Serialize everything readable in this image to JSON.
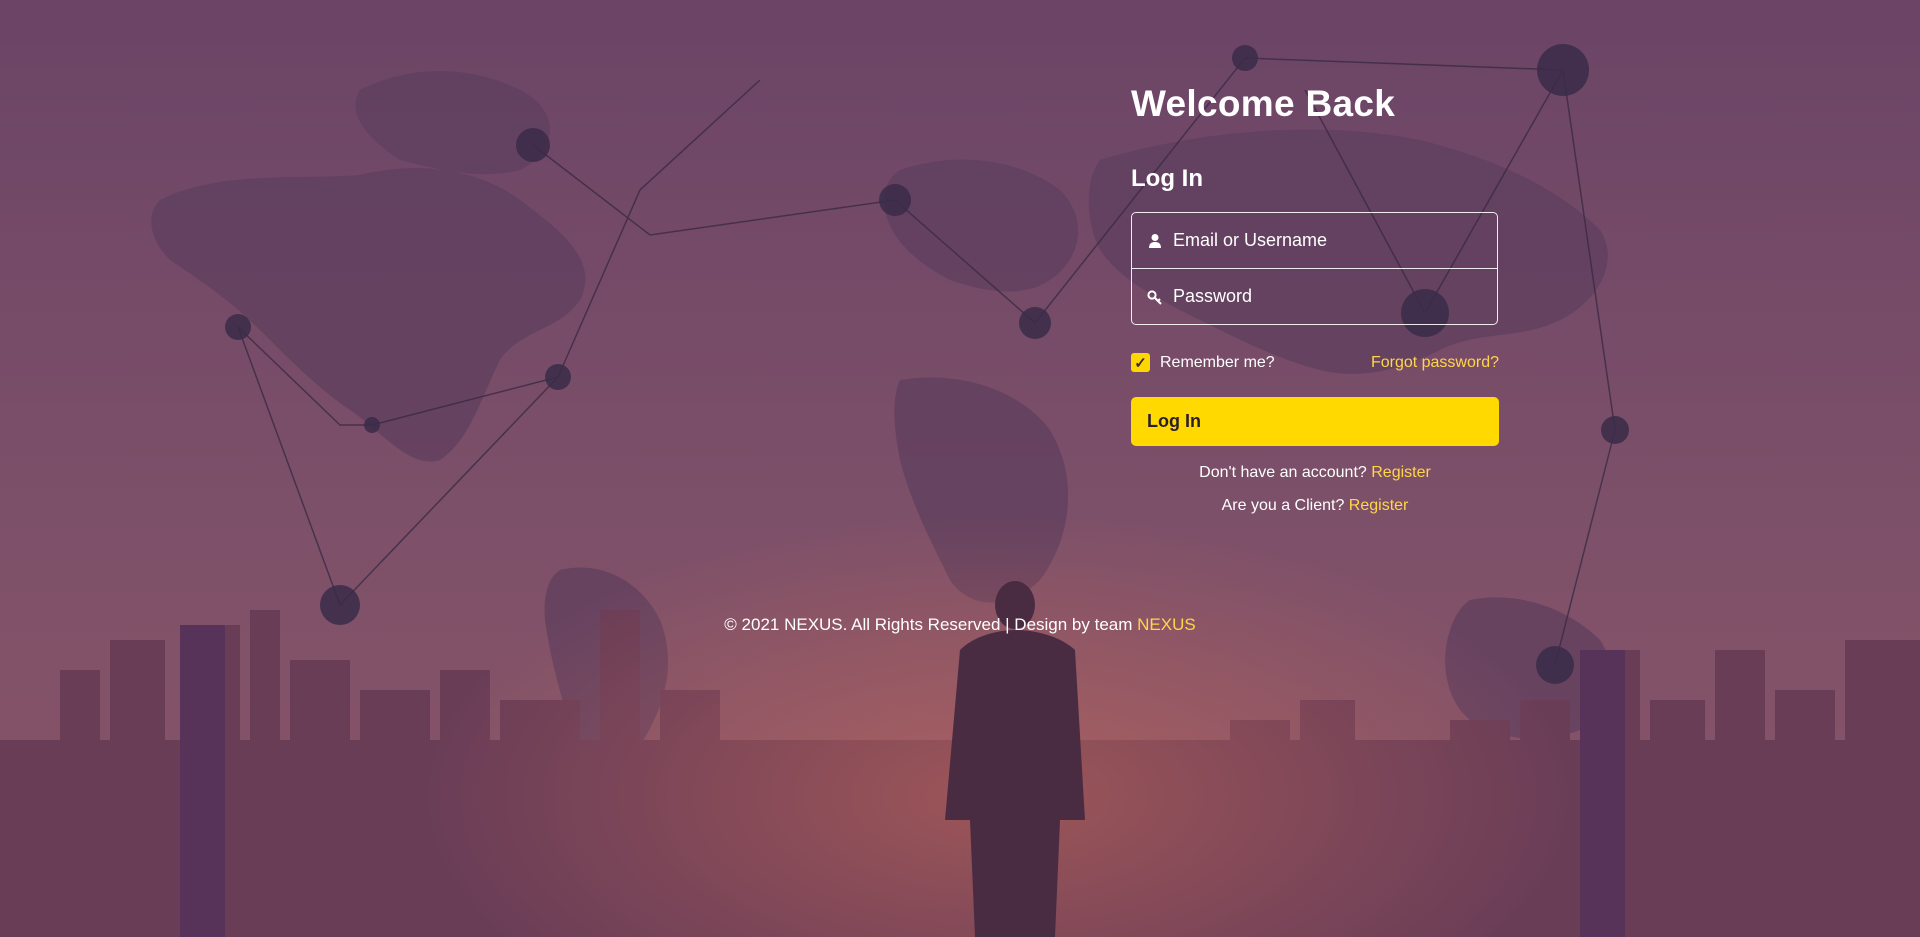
{
  "login": {
    "welcome_title": "Welcome Back",
    "heading": "Log In",
    "username_placeholder": "Email or Username",
    "password_placeholder": "Password",
    "remember_label": "Remember me?",
    "remember_checked": true,
    "forgot_label": "Forgot password?",
    "submit_label": "Log In",
    "no_account_text": "Don't have an account?",
    "register_label": "Register",
    "client_text": "Are you a Client?",
    "client_register_label": "Register"
  },
  "footer": {
    "text": "© 2021 NEXUS. All Rights Reserved | Design by team",
    "brand": "NEXUS"
  },
  "icons": {
    "username": "user-icon",
    "password": "key-icon",
    "check": "check-icon"
  },
  "colors": {
    "accent": "#ffd900",
    "link": "#ffd54a",
    "overlay": "#7a4d68"
  }
}
